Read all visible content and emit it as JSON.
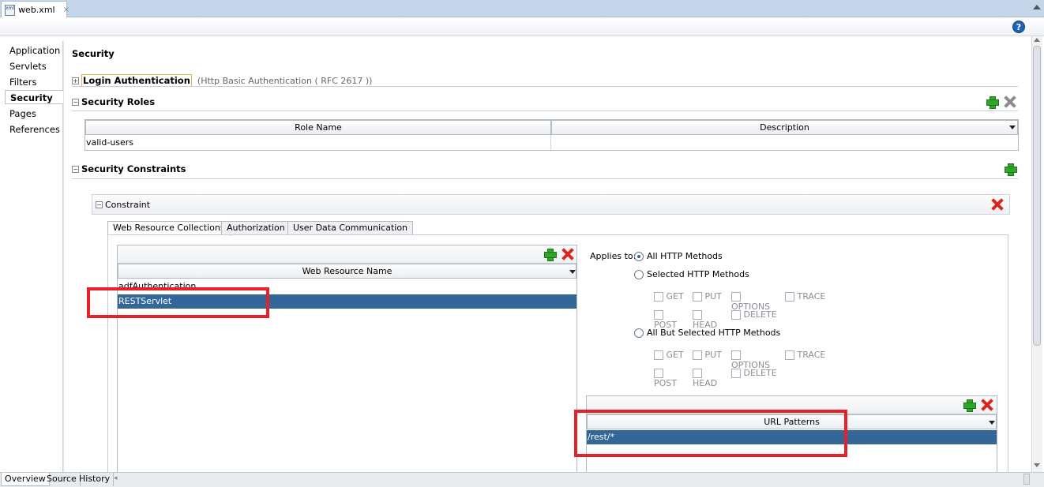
{
  "editor_tab": {
    "filename": "web.xml",
    "close": "×",
    "icon": "xml-file-icon"
  },
  "help_label": "?",
  "nav": {
    "items": [
      {
        "label": "Application"
      },
      {
        "label": "Servlets"
      },
      {
        "label": "Filters"
      },
      {
        "label": "Security",
        "active": true
      },
      {
        "label": "Pages"
      },
      {
        "label": "References"
      }
    ]
  },
  "page": {
    "title": "Security"
  },
  "login_auth": {
    "label": "Login Authentication",
    "detail": "(Http Basic Authentication ( RFC 2617 ))"
  },
  "security_roles": {
    "label": "Security Roles",
    "columns": [
      "Role Name",
      "Description"
    ],
    "rows": [
      {
        "role": "valid-users",
        "description": ""
      }
    ]
  },
  "security_constraints": {
    "label": "Security Constraints"
  },
  "constraint": {
    "label": "Constraint",
    "tabs": [
      "Web Resource Collections",
      "Authorization",
      "User Data Communication"
    ],
    "selected_tab": "Web Resource Collections"
  },
  "web_resources": {
    "column": "Web Resource Name",
    "rows": [
      "adfAuthentication",
      "RESTServlet"
    ],
    "selected": "RESTServlet"
  },
  "methods": {
    "applies_to": "Applies to:",
    "all": "All HTTP Methods",
    "selected": "Selected HTTP Methods",
    "all_but": "All But Selected HTTP Methods",
    "row1": [
      "GET",
      "PUT",
      "OPTIONS",
      "TRACE"
    ],
    "row2": [
      "POST",
      "HEAD",
      "DELETE"
    ]
  },
  "url_patterns": {
    "column": "URL Patterns",
    "rows": [
      "/rest/*"
    ]
  },
  "bottom_tabs": [
    "Overview",
    "Source",
    "History"
  ],
  "colors": {
    "selection": "#336699",
    "highlight_box": "#e5222a",
    "add": "#2fa52a",
    "remove": "#d9261c"
  }
}
